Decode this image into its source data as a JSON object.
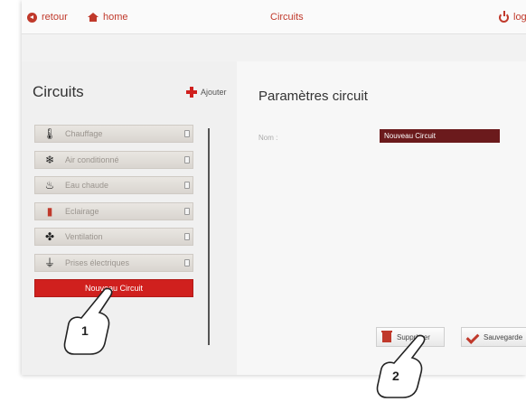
{
  "header": {
    "back_label": "retour",
    "home_label": "home",
    "title": "Circuits",
    "logout_label": "logo"
  },
  "sidebar": {
    "title": "Circuits",
    "add_label": "Ajouter",
    "items": [
      {
        "label": "Chauffage",
        "icon": "thermometer-icon"
      },
      {
        "label": "Air conditionné",
        "icon": "snowflake-icon"
      },
      {
        "label": "Eau chaude",
        "icon": "water-heater-icon"
      },
      {
        "label": "Eclairage",
        "icon": "lamp-icon"
      },
      {
        "label": "Ventilation",
        "icon": "fan-icon"
      },
      {
        "label": "Prises électriques",
        "icon": "plug-icon"
      }
    ],
    "selected_item": "Nouveau Circuit"
  },
  "main": {
    "title": "Paramètres circuit",
    "name_label": "Nom :",
    "name_value": "Nouveau Circuit",
    "delete_label": "Supprimer",
    "save_label": "Sauvegarde"
  },
  "callouts": {
    "first": "1",
    "second": "2"
  },
  "colors": {
    "accent": "#d0201e",
    "input_bg": "#6b1a1c"
  }
}
